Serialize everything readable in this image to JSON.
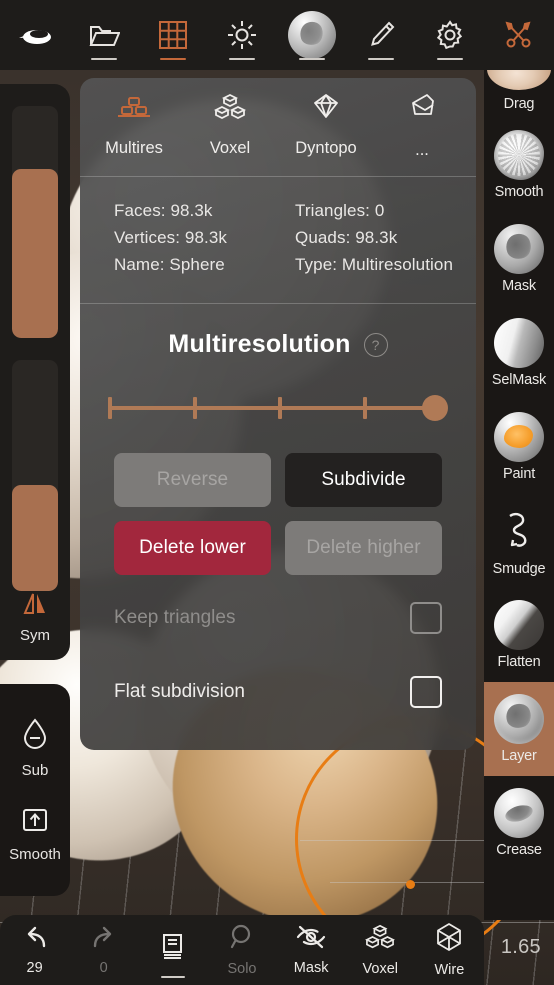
{
  "topbar": {
    "items": [
      {
        "icon": "pebble-logo-icon",
        "label": "",
        "accent": false,
        "dashes": 0
      },
      {
        "icon": "folder-icon",
        "label": "",
        "accent": false,
        "dashes": 1
      },
      {
        "icon": "grid-scene-icon",
        "label": "",
        "accent": true,
        "dashes": 1
      },
      {
        "icon": "lighting-sun-icon",
        "label": "",
        "accent": false,
        "dashes": 1
      },
      {
        "icon": "material-sphere-icon",
        "label": "",
        "accent": false,
        "dashes": 1
      },
      {
        "icon": "brush-pen-icon",
        "label": "",
        "accent": false,
        "dashes": 1
      },
      {
        "icon": "settings-gear-icon",
        "label": "",
        "accent": false,
        "dashes": 1
      },
      {
        "icon": "tools-wrench-icon",
        "label": "",
        "accent": true,
        "dashes": 0
      }
    ]
  },
  "left_sidebar": {
    "radius_slider": {
      "name": "radius-slider",
      "fill_percent": 73
    },
    "intensity_slider": {
      "name": "intensity-slider",
      "fill_percent": 46
    },
    "symmetry": {
      "icon": "symmetry-mirror-icon",
      "label": "Sym",
      "active": true
    }
  },
  "left_sidebar_lower": {
    "items": [
      {
        "icon": "sub-droplet-icon",
        "label": "Sub"
      },
      {
        "icon": "smooth-box-arrow-icon",
        "label": "Smooth"
      }
    ]
  },
  "right_sidebar": {
    "brushes": [
      {
        "label": "Drag",
        "thumb": "t-drag",
        "active": false,
        "partial": true
      },
      {
        "label": "Smooth",
        "thumb": "t-smooth",
        "active": false,
        "partial": false
      },
      {
        "label": "Mask",
        "thumb": "t-mask",
        "active": false,
        "partial": false
      },
      {
        "label": "SelMask",
        "thumb": "t-selmask",
        "active": false,
        "partial": false
      },
      {
        "label": "Paint",
        "thumb": "t-paint",
        "active": false,
        "partial": false
      },
      {
        "label": "Smudge",
        "thumb": "t-smudge",
        "active": false,
        "partial": false
      },
      {
        "label": "Flatten",
        "thumb": "t-flatten",
        "active": false,
        "partial": false
      },
      {
        "label": "Layer",
        "thumb": "t-layer",
        "active": true,
        "partial": false
      },
      {
        "label": "Crease",
        "thumb": "t-crease",
        "active": false,
        "partial": false
      }
    ]
  },
  "panel": {
    "tabs": [
      {
        "label": "Multires",
        "icon": "multires-bricks-icon",
        "active": true
      },
      {
        "label": "Voxel",
        "icon": "voxel-cubes-icon",
        "active": false
      },
      {
        "label": "Dyntopo",
        "icon": "dyntopo-diamond-icon",
        "active": false
      },
      {
        "label": "...",
        "icon": "more-facet-icon",
        "active": false
      }
    ],
    "stats": [
      {
        "label": "Faces",
        "value": "98.3k",
        "text": "Faces: 98.3k"
      },
      {
        "label": "Triangles",
        "value": "0",
        "text": "Triangles: 0"
      },
      {
        "label": "Vertices",
        "value": "98.3k",
        "text": "Vertices: 98.3k"
      },
      {
        "label": "Quads",
        "value": "98.3k",
        "text": "Quads: 98.3k"
      },
      {
        "label": "Name",
        "value": "Sphere",
        "text": "Name: Sphere"
      },
      {
        "label": "Type",
        "value": "Multiresolution",
        "text": "Type: Multiresolution"
      }
    ],
    "section_title": "Multiresolution",
    "help_glyph": "?",
    "level_slider": {
      "name": "multires-level-slider",
      "ticks": 5,
      "current_level": 5,
      "max_level": 5,
      "knob_position_percent": 100
    },
    "buttons": [
      {
        "label": "Reverse",
        "style": "disabled"
      },
      {
        "label": "Subdivide",
        "style": "dark"
      },
      {
        "label": "Delete lower",
        "style": "danger"
      },
      {
        "label": "Delete higher",
        "style": "disabled"
      }
    ],
    "checkboxes": [
      {
        "label": "Keep triangles",
        "checked": false,
        "disabled": true
      },
      {
        "label": "Flat subdivision",
        "checked": false,
        "disabled": false
      }
    ]
  },
  "bottombar": {
    "items": [
      {
        "icon": "undo-arrow-icon",
        "label": "29",
        "dim": false,
        "dashes": 0
      },
      {
        "icon": "redo-arrow-icon",
        "label": "0",
        "dim": true,
        "dashes": 0
      },
      {
        "icon": "layers-list-icon",
        "label": "",
        "dim": false,
        "dashes": 1
      },
      {
        "icon": "solo-magnifier-icon",
        "label": "Solo",
        "dim": true,
        "dashes": 0
      },
      {
        "icon": "mask-eye-off-icon",
        "label": "Mask",
        "dim": false,
        "dashes": 0
      },
      {
        "icon": "voxel-cubes-icon",
        "label": "Voxel",
        "dim": false,
        "dashes": 0
      },
      {
        "icon": "wire-polyhedron-icon",
        "label": "Wire",
        "dim": false,
        "dashes": 0
      }
    ]
  },
  "viewport": {
    "brush_cursor_value": "1.65",
    "model_name": "Sphere"
  },
  "colors": {
    "accent": "#b07a56",
    "active_brush_bg": "#a87050",
    "danger": "#a2273d",
    "cursor_orange": "#e87d14",
    "panel_bg": "#545454",
    "bar_bg": "#1e1c1a"
  }
}
